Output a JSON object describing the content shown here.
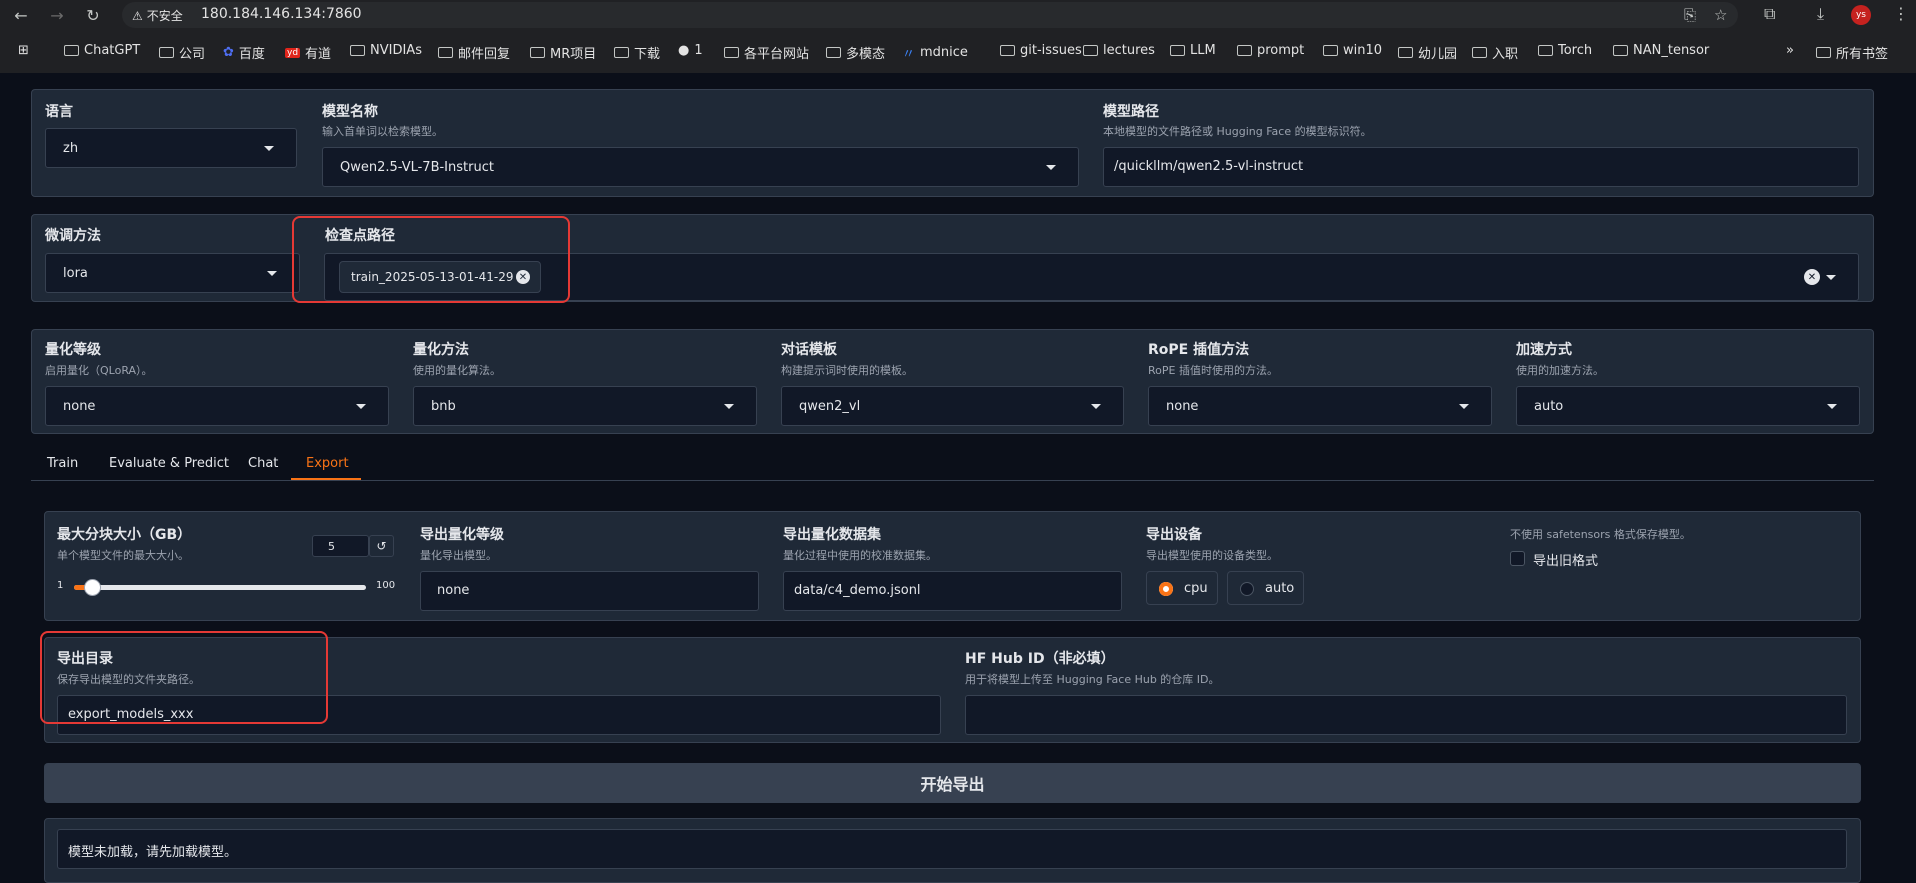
{
  "browser": {
    "security_label": "不安全",
    "url": "180.184.146.134:7860",
    "avatar": "ys",
    "bookmarks": [
      "ChatGPT",
      "公司",
      "百度",
      "有道",
      "NVIDIAs",
      "邮件回复",
      "MR项目",
      "下载",
      "1",
      "各平台网站",
      "多模态",
      "mdnice",
      "git-issues",
      "lectures",
      "LLM",
      "prompt",
      "win10",
      "幼儿园",
      "入职",
      "Torch",
      "NAN_tensor"
    ],
    "overflow": "»",
    "all_bookmarks": "所有书签"
  },
  "top": {
    "lang_label": "语言",
    "lang_value": "zh",
    "model_name_label": "模型名称",
    "model_name_info": "输入首单词以检索模型。",
    "model_name_value": "Qwen2.5-VL-7B-Instruct",
    "model_path_label": "模型路径",
    "model_path_info": "本地模型的文件路径或 Hugging Face 的模型标识符。",
    "model_path_value": "/quickllm/qwen2.5-vl-instruct"
  },
  "finetune": {
    "method_label": "微调方法",
    "method_value": "lora",
    "ckpt_label": "检查点路径",
    "ckpt_value": "train_2025-05-13-01-41-29"
  },
  "quant": {
    "bit_label": "量化等级",
    "bit_info": "启用量化（QLoRA）。",
    "bit_value": "none",
    "method_label": "量化方法",
    "method_info": "使用的量化算法。",
    "method_value": "bnb",
    "template_label": "对话模板",
    "template_info": "构建提示词时使用的模板。",
    "template_value": "qwen2_vl",
    "rope_label": "RoPE 插值方法",
    "rope_info": "RoPE 插值时使用的方法。",
    "rope_value": "none",
    "booster_label": "加速方式",
    "booster_info": "使用的加速方法。",
    "booster_value": "auto"
  },
  "tabs": [
    "Train",
    "Evaluate & Predict",
    "Chat",
    "Export"
  ],
  "export": {
    "size_label": "最大分块大小（GB）",
    "size_info": "单个模型文件的最大大小。",
    "size_value": "5",
    "size_min": "1",
    "size_max": "100",
    "size_fraction": 0.04,
    "quant_bit_label": "导出量化等级",
    "quant_bit_info": "量化导出模型。",
    "quant_bit_value": "none",
    "dataset_label": "导出量化数据集",
    "dataset_info": "量化过程中使用的校准数据集。",
    "dataset_value": "data/c4_demo.jsonl",
    "device_label": "导出设备",
    "device_info": "导出模型使用的设备类型。",
    "device_cpu": "cpu",
    "device_auto": "auto",
    "legacy_info": "不使用 safetensors 格式保存模型。",
    "legacy_label": "导出旧格式",
    "dir_label": "导出目录",
    "dir_info": "保存导出模型的文件夹路径。",
    "dir_value": "export_models_xxx",
    "hub_label": "HF Hub ID（非必填）",
    "hub_info": "用于将模型上传至 Hugging Face Hub 的仓库 ID。",
    "hub_value": "",
    "button": "开始导出",
    "status": "模型未加载，请先加载模型。"
  },
  "colors": {
    "accent": "#f97316",
    "highlight": "#e53935",
    "panel": "#1f2937",
    "bg": "#0b0f19"
  }
}
